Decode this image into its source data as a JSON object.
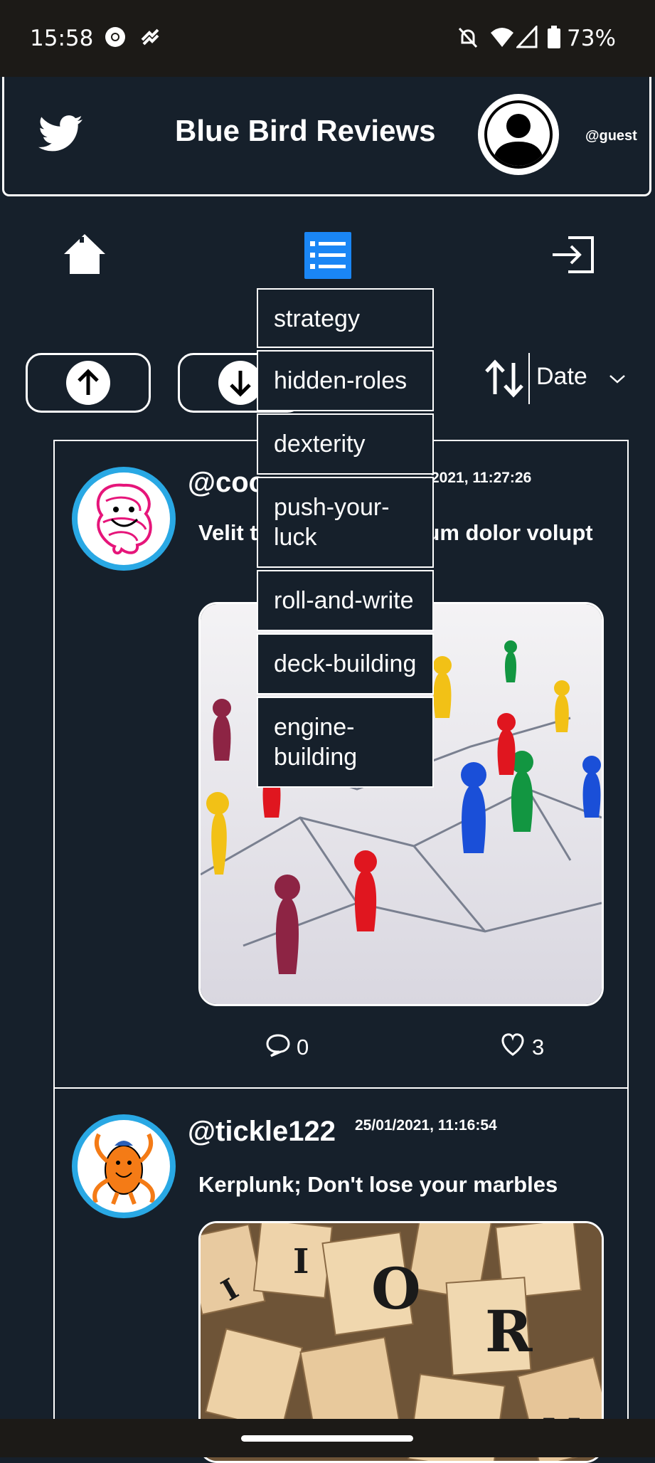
{
  "status_bar": {
    "time": "15:58",
    "battery": "73%"
  },
  "header": {
    "title": "Blue Bird Reviews",
    "username": "@guest"
  },
  "sort": {
    "selected": "Date"
  },
  "dropdown": {
    "items": [
      "strategy",
      "hidden-roles",
      "dexterity",
      "push-your-luck",
      "roll-and-write",
      "deck-building",
      "engine-building"
    ]
  },
  "posts": [
    {
      "handle": "@coo",
      "date": "2021, 11:27:26",
      "text": "Velit t             amet ipsum dolor volupt",
      "comments": "0",
      "likes": "3"
    },
    {
      "handle": "@tickle122",
      "date": "25/01/2021, 11:16:54",
      "text": "Kerplunk; Don't lose your marbles"
    }
  ],
  "colors": {
    "background": "#16202b",
    "accent": "#1a86f5",
    "avatar_ring": "#29a8e4"
  }
}
